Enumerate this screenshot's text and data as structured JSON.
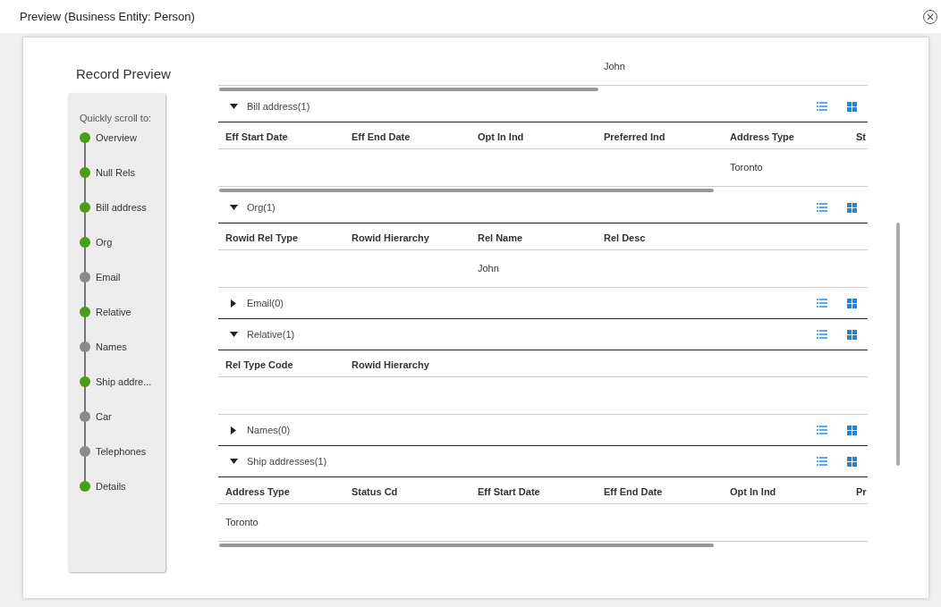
{
  "dialog": {
    "title": "Preview (Business Entity: Person)"
  },
  "record_preview": {
    "title": "Record Preview",
    "scroll_label": "Quickly scroll to:",
    "items": [
      {
        "label": "Overview",
        "has_data": true
      },
      {
        "label": "Null Rels",
        "has_data": true
      },
      {
        "label": "Bill address",
        "has_data": true
      },
      {
        "label": "Org",
        "has_data": true
      },
      {
        "label": "Email",
        "has_data": false
      },
      {
        "label": "Relative",
        "has_data": true
      },
      {
        "label": "Names",
        "has_data": false
      },
      {
        "label": "Ship addre...",
        "has_data": true
      },
      {
        "label": "Car",
        "has_data": false
      },
      {
        "label": "Telephones",
        "has_data": false
      },
      {
        "label": "Details",
        "has_data": true
      }
    ]
  },
  "top_fragment": {
    "rows": [
      [
        null,
        null,
        null,
        "John"
      ]
    ],
    "h_scrollbar": true
  },
  "sections": [
    {
      "title": "Bill address(1)",
      "expanded": true,
      "columns": [
        "Eff Start Date",
        "Eff End Date",
        "Opt In Ind",
        "Preferred Ind",
        "Address Type",
        "St"
      ],
      "rows": [
        [
          null,
          null,
          null,
          null,
          "Toronto",
          null
        ]
      ],
      "h_scrollbar": true
    },
    {
      "title": "Org(1)",
      "expanded": true,
      "columns": [
        "Rowid Rel Type",
        "Rowid Hierarchy",
        "Rel Name",
        "Rel Desc"
      ],
      "rows": [
        [
          null,
          null,
          "John",
          null
        ]
      ],
      "h_scrollbar": false
    },
    {
      "title": "Email(0)",
      "expanded": false
    },
    {
      "title": "Relative(1)",
      "expanded": true,
      "columns": [
        "Rel Type Code",
        "Rowid Hierarchy"
      ],
      "rows": [
        [
          null,
          null
        ]
      ],
      "h_scrollbar": false
    },
    {
      "title": "Names(0)",
      "expanded": false
    },
    {
      "title": "Ship addresses(1)",
      "expanded": true,
      "columns": [
        "Address Type",
        "Status Cd",
        "Eff Start Date",
        "Eff End Date",
        "Opt In Ind",
        "Pr"
      ],
      "rows": [
        [
          "Toronto",
          null,
          null,
          null,
          null,
          null
        ]
      ],
      "h_scrollbar": true
    }
  ]
}
